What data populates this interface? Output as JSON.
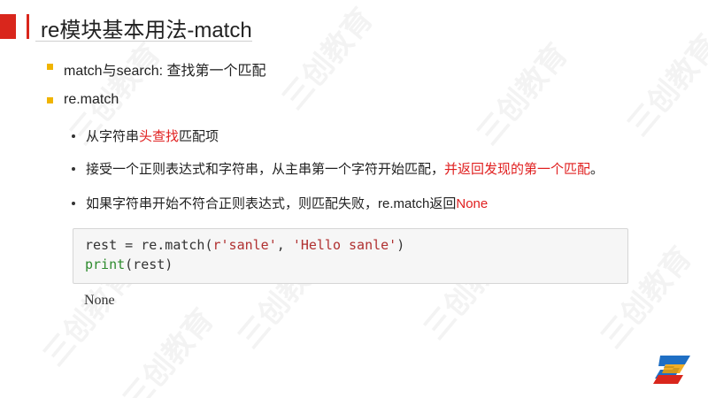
{
  "slide": {
    "title": "re模块基本用法-match",
    "bullets": [
      {
        "text": "match与search: 查找第一个匹配"
      },
      {
        "text": "re.match"
      }
    ],
    "sub_bullets": [
      {
        "before": "从字符串",
        "highlight": "头查找",
        "after": "匹配项"
      },
      {
        "before": "接受一个正则表达式和字符串，从主串第一个字符开始匹配，",
        "highlight": "并返回发现的第一个匹配",
        "after": "。"
      },
      {
        "before": "如果字符串开始不符合正则表达式，则匹配失败，re.match返回",
        "highlight": "None",
        "after": ""
      }
    ],
    "code": {
      "line1": {
        "a": "rest = re.match(",
        "s1": "r'sanle'",
        "b": ", ",
        "s2": "'Hello sanle'",
        "c": ")"
      },
      "line2": {
        "kw": "print",
        "rest": "(rest)"
      }
    },
    "output": "None",
    "watermark": "三创教育"
  },
  "colors": {
    "accent_red": "#d9261c",
    "highlight_red": "#e02020",
    "bullet_yellow": "#f0b400",
    "keyword_green": "#2e8b2e",
    "string_red": "#b03030"
  },
  "icons": {
    "logo": "sanchuang-s-logo-icon"
  }
}
